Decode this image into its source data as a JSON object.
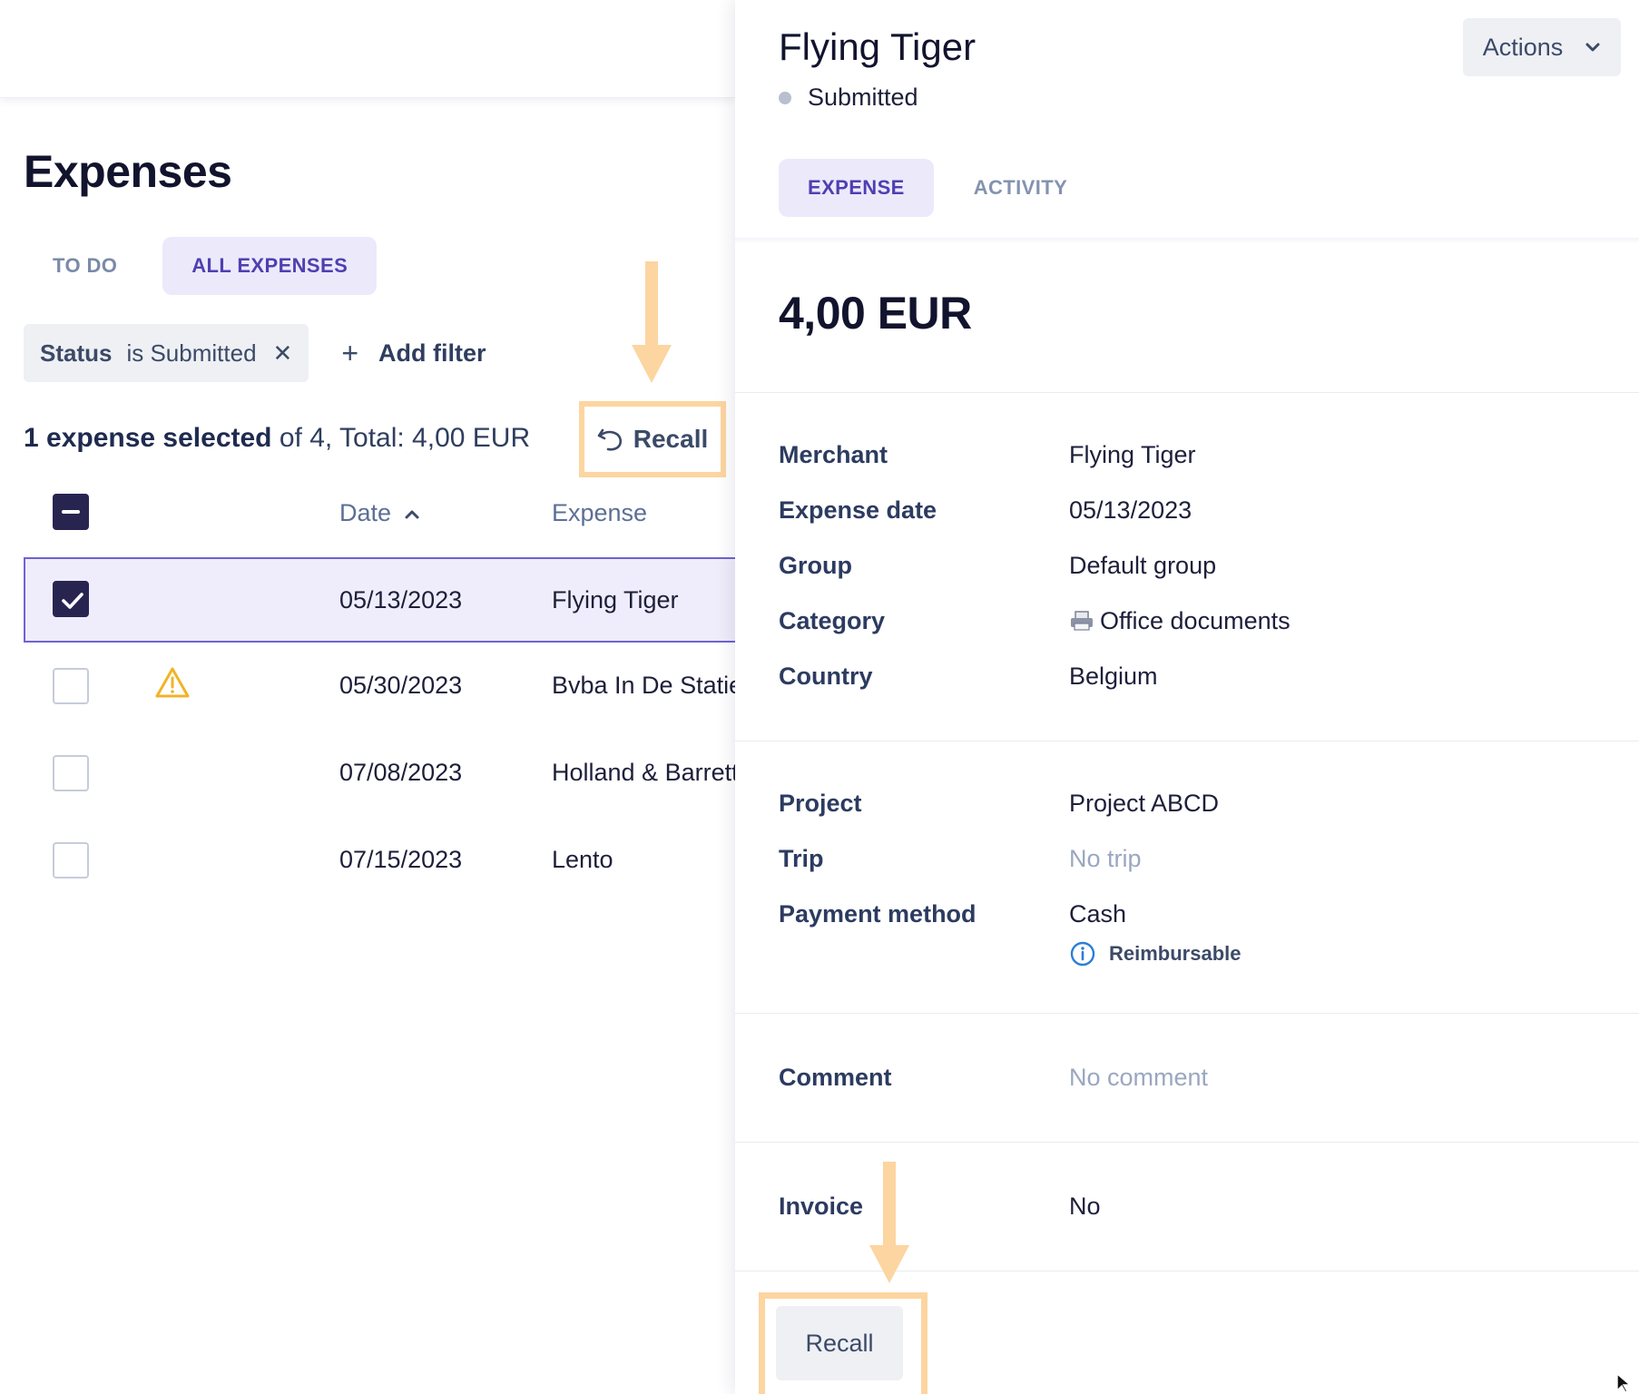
{
  "left": {
    "page_title": "Expenses",
    "tabs": [
      {
        "label": "TO DO",
        "active": false
      },
      {
        "label": "ALL EXPENSES",
        "active": true
      }
    ],
    "filter": {
      "key": "Status",
      "value": "is Submitted",
      "remove": "✕"
    },
    "add_filter_label": "Add filter",
    "add_filter_icon": "+",
    "selection": {
      "strong": "1 expense selected",
      "rest": " of 4, Total: 4,00 EUR"
    },
    "recall_label": "Recall",
    "table": {
      "headers": {
        "date": "Date",
        "expense": "Expense"
      },
      "rows": [
        {
          "date": "05/13/2023",
          "expense": "Flying Tiger",
          "selected": true,
          "warning": false
        },
        {
          "date": "05/30/2023",
          "expense": "Bvba In De Statie",
          "selected": false,
          "warning": true
        },
        {
          "date": "07/08/2023",
          "expense": "Holland & Barrett",
          "selected": false,
          "warning": false
        },
        {
          "date": "07/15/2023",
          "expense": "Lento",
          "selected": false,
          "warning": false
        }
      ]
    }
  },
  "panel": {
    "title": "Flying Tiger",
    "status": "Submitted",
    "actions_label": "Actions",
    "tabs": [
      {
        "label": "EXPENSE",
        "active": true
      },
      {
        "label": "ACTIVITY",
        "active": false
      }
    ],
    "amount": "4,00 EUR",
    "details": [
      {
        "key": "Merchant",
        "value": "Flying Tiger"
      },
      {
        "key": "Expense date",
        "value": "05/13/2023"
      },
      {
        "key": "Group",
        "value": "Default group"
      },
      {
        "key": "Category",
        "value": "Office documents",
        "icon": "printer-icon"
      },
      {
        "key": "Country",
        "value": "Belgium"
      }
    ],
    "project_details": [
      {
        "key": "Project",
        "value": "Project ABCD"
      },
      {
        "key": "Trip",
        "value": "No trip",
        "muted": true
      },
      {
        "key": "Payment method",
        "value": "Cash"
      }
    ],
    "reimbursable_label": "Reimbursable",
    "comment": {
      "key": "Comment",
      "value": "No comment"
    },
    "invoice": {
      "key": "Invoice",
      "value": "No"
    },
    "recall_label": "Recall"
  },
  "colors": {
    "accent": "#4f3fb0",
    "accent_bg": "#ece9fb",
    "highlight": "#fcd5a0",
    "warning": "#f0b429",
    "info": "#2b7fd6",
    "checkbox_dark": "#272550"
  }
}
